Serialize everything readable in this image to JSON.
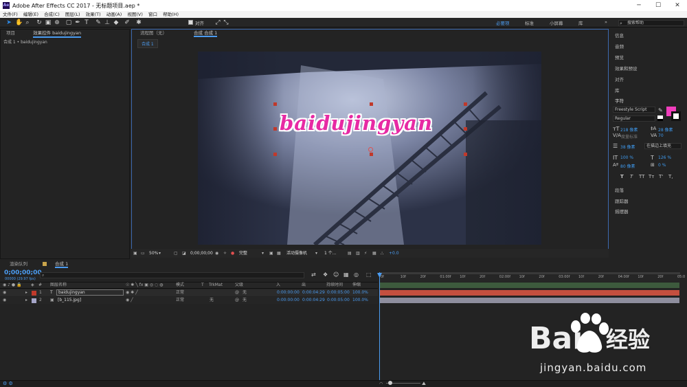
{
  "window": {
    "title": "Adobe After Effects CC 2017 - 无标题项目.aep *",
    "logo": "Ae",
    "min_icon": "─",
    "max_icon": "☐",
    "close_icon": "✕"
  },
  "menu": [
    "文件(F)",
    "编辑(E)",
    "合成(C)",
    "图层(L)",
    "效果(T)",
    "动画(A)",
    "视图(V)",
    "窗口",
    "帮助(H)"
  ],
  "toolbar": {
    "align_label": "对齐",
    "workspaces": [
      "必要项",
      "标准",
      "小屏幕",
      "库"
    ],
    "search_placeholder": "搜索帮助",
    "more_icon": "»"
  },
  "project_panel": {
    "tab_project": "项目",
    "tab_effects": "效果控件 baidujingyan",
    "breadcrumb": "合成 1 • baidujingyan"
  },
  "viewer": {
    "tab_flow": "流程图（无）",
    "tab_comp": "合成 合成 1",
    "comp_chip": "合成 1",
    "text_layer": "baidujingyan"
  },
  "viewer_bar": {
    "zoom": "50%",
    "timecode": "0;00;00;00",
    "resolution": "完整",
    "camera": "活动摄像机",
    "views": "1 个...",
    "exposure": "+0.0"
  },
  "right_panel": {
    "items_top": [
      "信息",
      "音频",
      "预览",
      "效果和预设",
      "对齐",
      "库"
    ],
    "character": {
      "title": "字符",
      "font": "Freestyle Script",
      "style": "Regular",
      "size": "218 像素",
      "leading": "28 像素",
      "kerning": "度量标准",
      "tracking": "70",
      "stroke": "38 像素",
      "stroke_mode": "在描边上填充",
      "vscale": "100 %",
      "hscale": "126 %",
      "baseline": "80 像素",
      "tsume": "0 %",
      "styles": [
        "T",
        "T",
        "TT",
        "Tт",
        "T'",
        "T,"
      ]
    },
    "items_bottom": [
      "段落",
      "跟踪器",
      "摇摆器"
    ],
    "fill_color": "#f03ebc"
  },
  "timeline": {
    "tab_render": "渲染队列",
    "tab_comp": "合成 1",
    "timecode": "0;00;00;00",
    "fps": "00000 (29.97 fps)",
    "headers": {
      "name": "图层名称",
      "mode": "模式",
      "t": "T",
      "trkmat": "TrkMat",
      "parent": "父级",
      "in": "入",
      "out": "出",
      "duration": "持续时间",
      "stretch": "伸缩"
    },
    "layers": [
      {
        "num": "1",
        "type": "T",
        "name": "baidujingyan",
        "mode": "正常",
        "trkmat": "",
        "parent": "无",
        "in": "0:00:00:00",
        "out": "0:00:04:29",
        "duration": "0:00:05:00",
        "stretch": "100.0%",
        "color": "#c0392b"
      },
      {
        "num": "2",
        "type": "",
        "name": "[b_115.jpg]",
        "mode": "正常",
        "trkmat": "无",
        "parent": "无",
        "in": "0:00:00:00",
        "out": "0:00:04:29",
        "duration": "0:00:05:00",
        "stretch": "100.0%",
        "color": "#a6a6c8"
      }
    ],
    "ruler": [
      "0f",
      "10f",
      "20f",
      "01:00f",
      "10f",
      "20f",
      "02:00f",
      "10f",
      "20f",
      "03:00f",
      "10f",
      "20f",
      "04:00f",
      "10f",
      "20f",
      "05:0"
    ]
  },
  "watermark": {
    "brand": "Bai",
    "brand2": "经验",
    "url": "jingyan.baidu.com"
  }
}
